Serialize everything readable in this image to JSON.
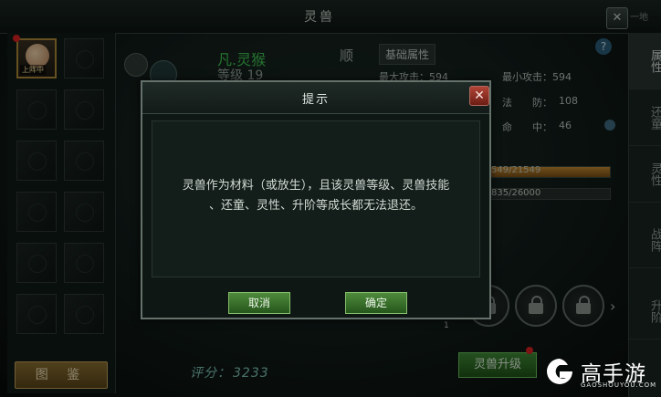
{
  "window": {
    "title": "灵兽",
    "close_icon": "close-icon",
    "top_right_text": "一地"
  },
  "left_panel": {
    "active_slot_tag": "上阵中",
    "manual_button_label": "图 鉴"
  },
  "pet": {
    "name": "凡.灵猴",
    "level": "等级 19",
    "trait": "顺",
    "tab_basic": "基础属性",
    "stats": {
      "max_attack": "最大攻击：594",
      "min_attack": "最小攻击：594",
      "magic_defense_label": "法　　防：",
      "magic_defense_value": "108",
      "hit_label": "命　　中：",
      "hit_value": "46"
    },
    "bars": [
      {
        "text": "549/21549",
        "fill": 1.0
      },
      {
        "text": "835/26000",
        "fill": 0.0
      }
    ],
    "score_label": "评分：",
    "score_value": "3233",
    "upgrade_button": "灵兽升级",
    "small_number": "1"
  },
  "right_tabs": [
    {
      "label": "属性",
      "active": true
    },
    {
      "label": "还童",
      "active": false
    },
    {
      "label": "灵性",
      "active": false
    },
    {
      "label": "战阵",
      "active": false
    },
    {
      "label": "升阶",
      "active": false
    }
  ],
  "dialog": {
    "title": "提示",
    "message_line1": "灵兽作为材料（或放生），且该灵兽等级、灵兽技能",
    "message_line2": "、还童、灵性、升阶等成长都无法退还。",
    "cancel_label": "取消",
    "ok_label": "确定"
  },
  "watermark": {
    "brand": "高手游",
    "url": "GAOSHOUYOU.COM"
  },
  "colors": {
    "accent_green": "#41c552",
    "dialog_button": "#4e8a3b",
    "close_red": "#b14436"
  }
}
